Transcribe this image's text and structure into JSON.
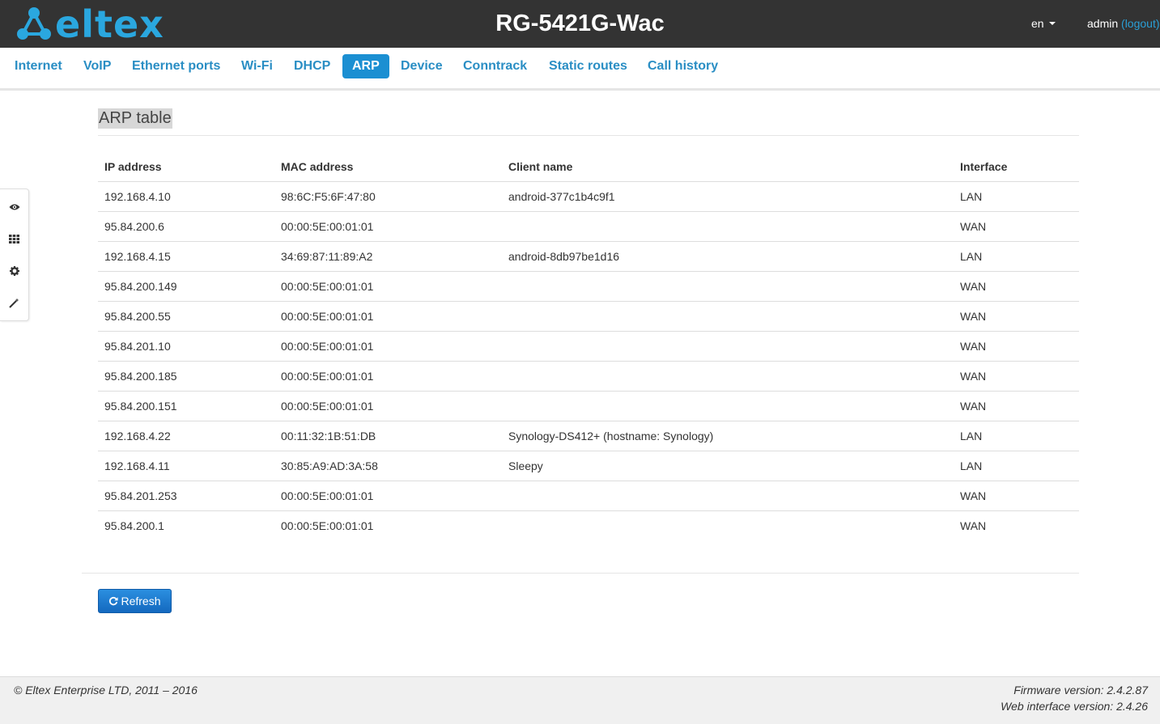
{
  "header": {
    "logo_text": "eltex",
    "device_title": "RG-5421G-Wac",
    "language": "en",
    "user": "admin",
    "logout_label": "(logout)"
  },
  "tabs": [
    {
      "label": "Internet"
    },
    {
      "label": "VoIP"
    },
    {
      "label": "Ethernet ports"
    },
    {
      "label": "Wi-Fi"
    },
    {
      "label": "DHCP"
    },
    {
      "label": "ARP",
      "active": true
    },
    {
      "label": "Device"
    },
    {
      "label": "Conntrack"
    },
    {
      "label": "Static routes"
    },
    {
      "label": "Call history"
    }
  ],
  "side_toolbar": [
    "eye-icon",
    "grid-icon",
    "gear-icon",
    "wand-icon"
  ],
  "section": {
    "title": "ARP table",
    "columns": [
      "IP address",
      "MAC address",
      "Client name",
      "Interface"
    ],
    "rows": [
      [
        "192.168.4.10",
        "98:6C:F5:6F:47:80",
        "android-377c1b4c9f1",
        "LAN"
      ],
      [
        "95.84.200.6",
        "00:00:5E:00:01:01",
        "",
        "WAN"
      ],
      [
        "192.168.4.15",
        "34:69:87:11:89:A2",
        "android-8db97be1d16",
        "LAN"
      ],
      [
        "95.84.200.149",
        "00:00:5E:00:01:01",
        "",
        "WAN"
      ],
      [
        "95.84.200.55",
        "00:00:5E:00:01:01",
        "",
        "WAN"
      ],
      [
        "95.84.201.10",
        "00:00:5E:00:01:01",
        "",
        "WAN"
      ],
      [
        "95.84.200.185",
        "00:00:5E:00:01:01",
        "",
        "WAN"
      ],
      [
        "95.84.200.151",
        "00:00:5E:00:01:01",
        "",
        "WAN"
      ],
      [
        "192.168.4.22",
        "00:11:32:1B:51:DB",
        "Synology-DS412+ (hostname: Synology)",
        "LAN"
      ],
      [
        "192.168.4.11",
        "30:85:A9:AD:3A:58",
        "Sleepy",
        "LAN"
      ],
      [
        "95.84.201.253",
        "00:00:5E:00:01:01",
        "",
        "WAN"
      ],
      [
        "95.84.200.1",
        "00:00:5E:00:01:01",
        "",
        "WAN"
      ]
    ],
    "refresh_label": "Refresh"
  },
  "footer": {
    "copyright": "© Eltex Enterprise LTD, 2011 – 2016",
    "firmware_version": "Firmware version: 2.4.2.87",
    "web_interface_version": "Web interface version: 2.4.26"
  },
  "colors": {
    "header_bg": "#333333",
    "accent": "#2a8ec4",
    "active_tab": "#1b8fd2",
    "button": "#1d7ad0"
  }
}
